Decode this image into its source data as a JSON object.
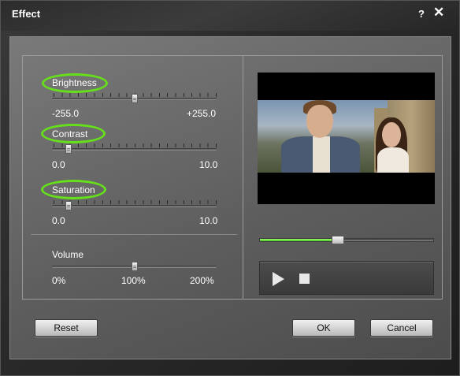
{
  "window": {
    "title": "Effect",
    "help_label": "?",
    "close_label": "✕"
  },
  "sliders": {
    "brightness": {
      "label": "Brightness",
      "min_label": "-255.0",
      "max_label": "+255.0",
      "min": -255,
      "max": 255,
      "value": 0
    },
    "contrast": {
      "label": "Contrast",
      "min_label": "0.0",
      "max_label": "10.0",
      "min": 0,
      "max": 10,
      "value": 1
    },
    "saturation": {
      "label": "Saturation",
      "min_label": "0.0",
      "max_label": "10.0",
      "min": 0,
      "max": 10,
      "value": 1
    },
    "volume": {
      "label": "Volume",
      "min_label": "0%",
      "mid_label": "100%",
      "max_label": "200%",
      "min": 0,
      "max": 200,
      "value": 100
    }
  },
  "preview": {
    "seek_fraction": 0.45
  },
  "icons": {
    "play": "play-icon",
    "stop": "stop-icon"
  },
  "colors": {
    "highlight_ellipse": "#66e01a",
    "seek_fill": "#6ee040"
  },
  "buttons": {
    "reset": "Reset",
    "ok": "OK",
    "cancel": "Cancel"
  }
}
